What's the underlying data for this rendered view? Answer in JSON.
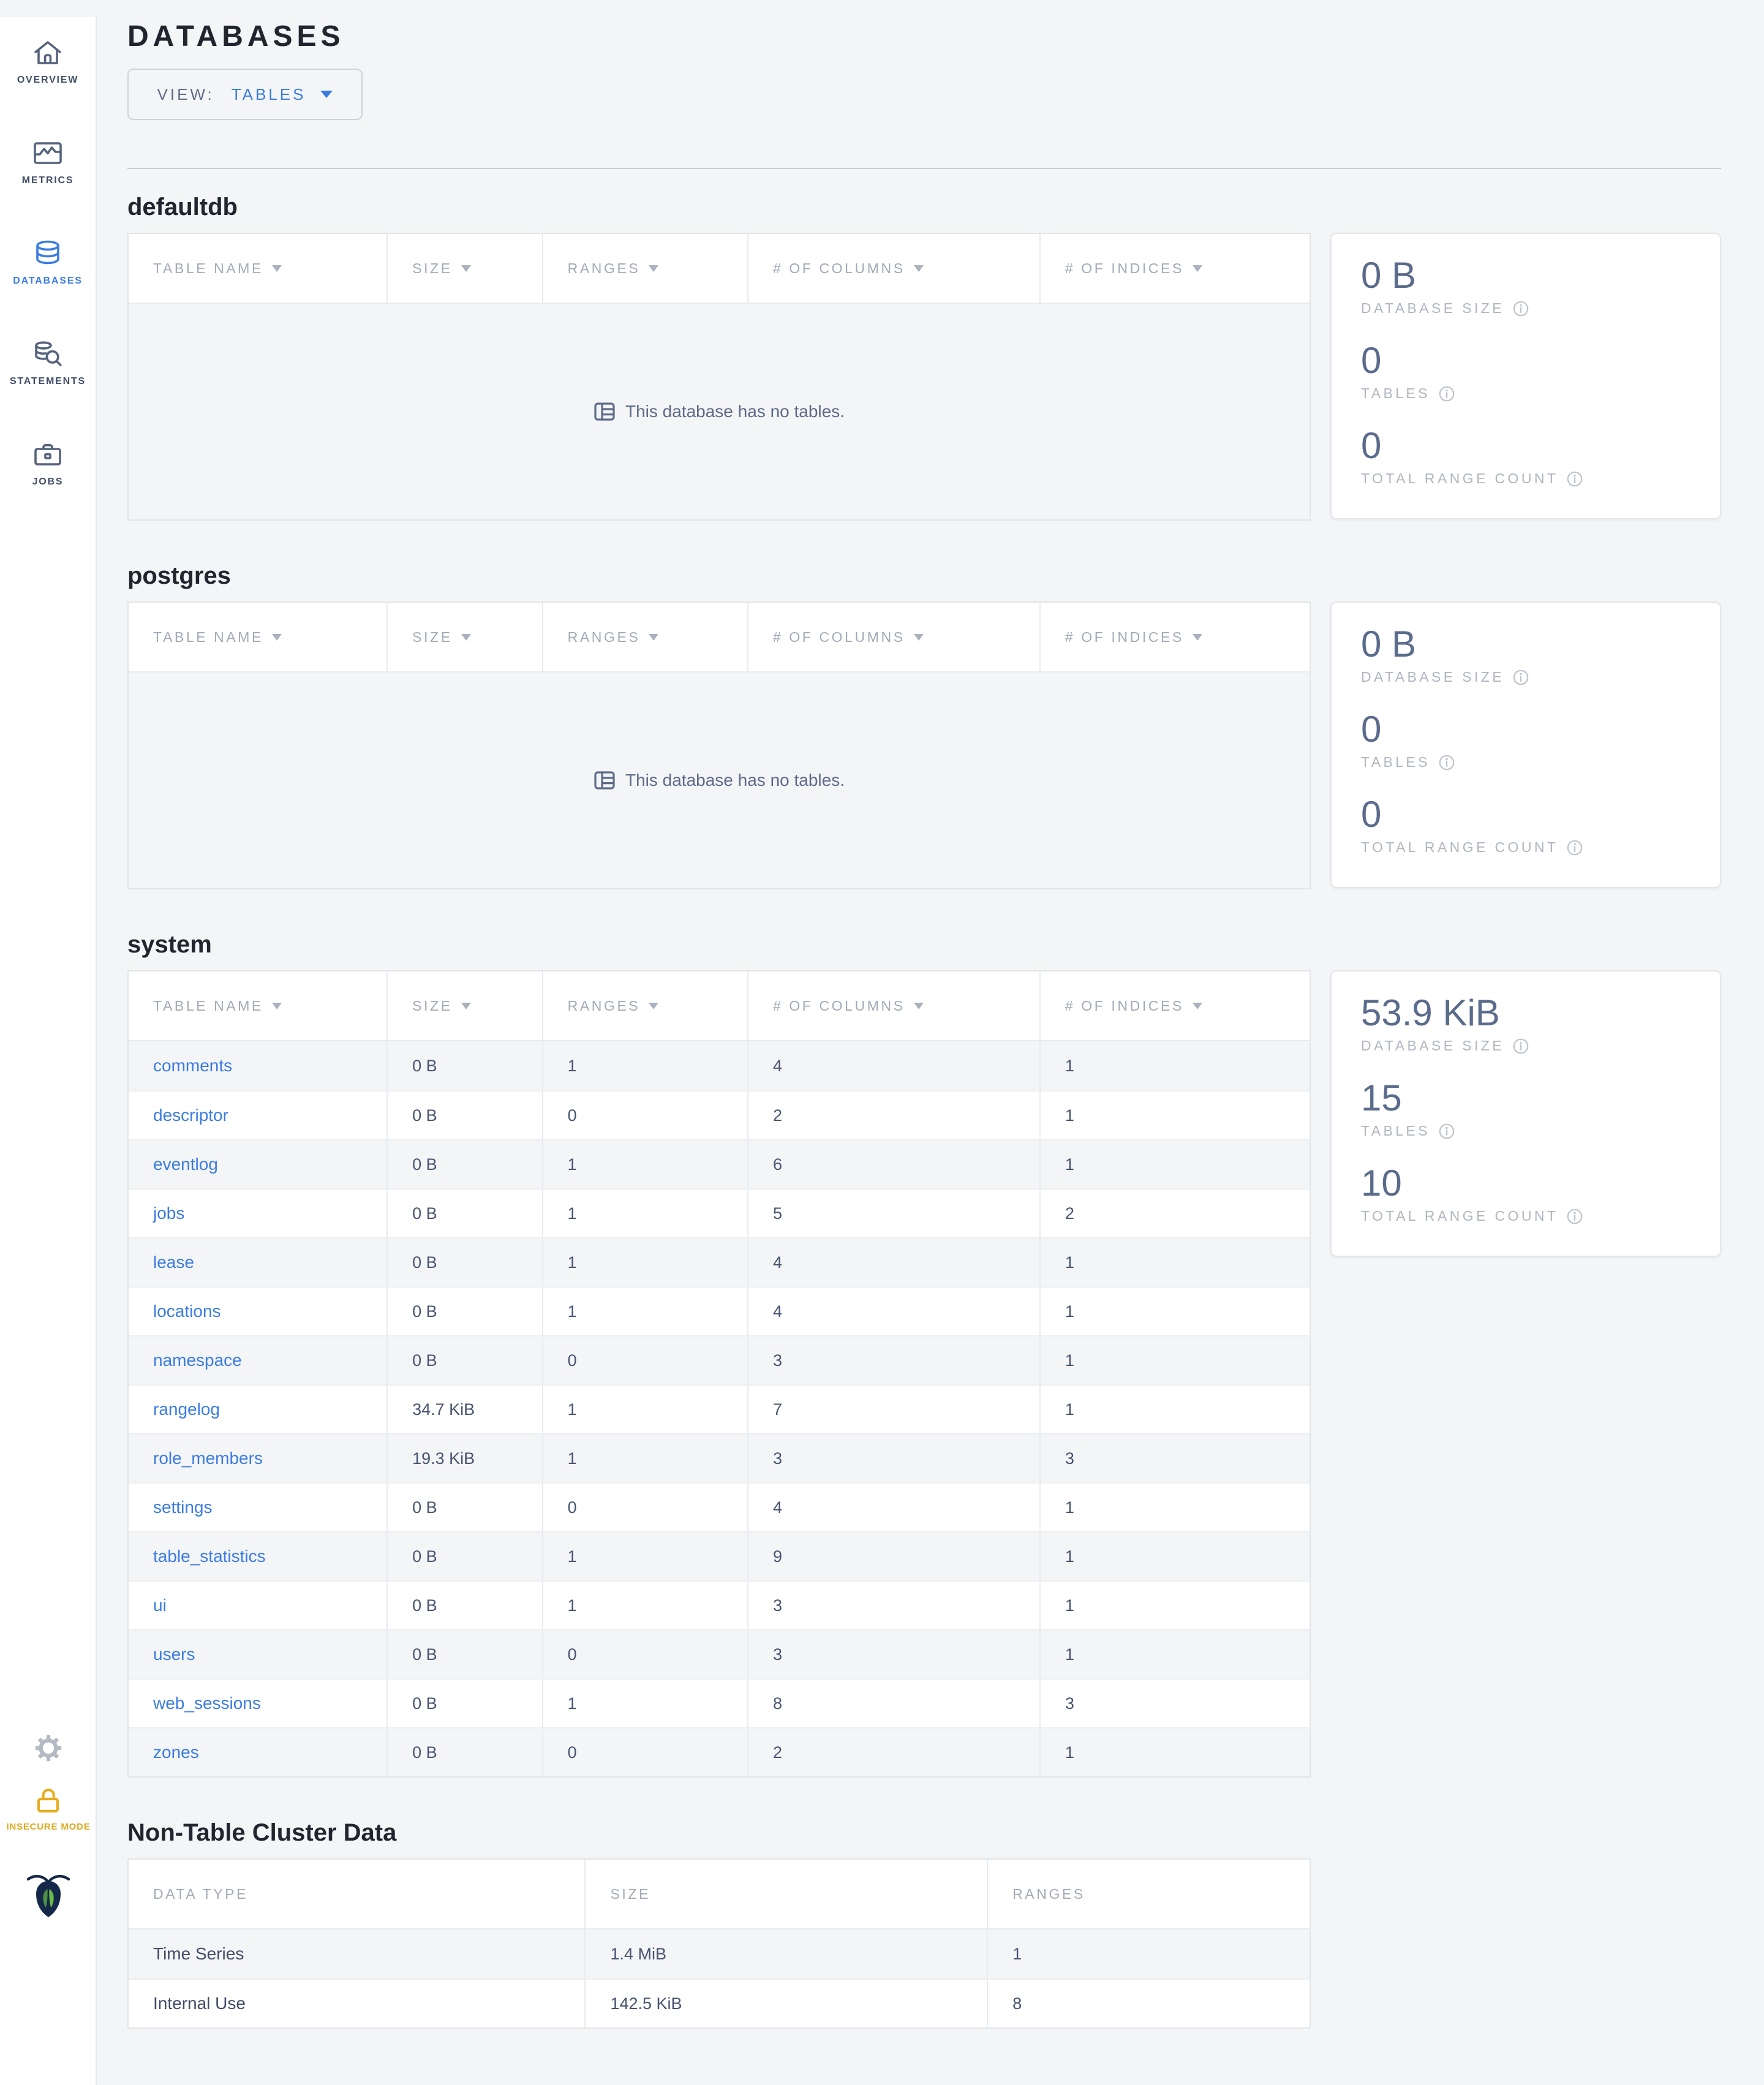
{
  "page": {
    "title": "DATABASES"
  },
  "view_selector": {
    "label": "VIEW:",
    "value": "TABLES"
  },
  "colors": {
    "accent_blue": "#3B7CE2",
    "insecure_yellow": "#E7AC1F",
    "stat_slate": "#5A6B8C"
  },
  "sidebar": {
    "items": [
      {
        "label": "OVERVIEW",
        "icon": "home-icon",
        "active": false
      },
      {
        "label": "METRICS",
        "icon": "metrics-icon",
        "active": false
      },
      {
        "label": "DATABASES",
        "icon": "database-icon",
        "active": true
      },
      {
        "label": "STATEMENTS",
        "icon": "statements-icon",
        "active": false
      },
      {
        "label": "JOBS",
        "icon": "jobs-icon",
        "active": false
      }
    ],
    "footer": {
      "gear_icon": "gear-icon",
      "insecure_mode": {
        "label": "INSECURE MODE",
        "icon": "unlock-icon"
      },
      "logo_icon": "cockroach-logo"
    }
  },
  "table_columns": [
    {
      "label": "TABLE NAME"
    },
    {
      "label": "SIZE"
    },
    {
      "label": "RANGES"
    },
    {
      "label": "# OF COLUMNS"
    },
    {
      "label": "# OF INDICES"
    }
  ],
  "empty_message": "This database has no tables.",
  "stats_labels": {
    "size": "DATABASE SIZE",
    "tables": "TABLES",
    "ranges": "TOTAL RANGE COUNT"
  },
  "databases": [
    {
      "name": "defaultdb",
      "empty": true,
      "stats": {
        "size": "0 B",
        "tables": "0",
        "ranges": "0"
      },
      "rows": []
    },
    {
      "name": "postgres",
      "empty": true,
      "stats": {
        "size": "0 B",
        "tables": "0",
        "ranges": "0"
      },
      "rows": []
    },
    {
      "name": "system",
      "empty": false,
      "stats": {
        "size": "53.9 KiB",
        "tables": "15",
        "ranges": "10"
      },
      "rows": [
        [
          "comments",
          "0 B",
          "1",
          "4",
          "1"
        ],
        [
          "descriptor",
          "0 B",
          "0",
          "2",
          "1"
        ],
        [
          "eventlog",
          "0 B",
          "1",
          "6",
          "1"
        ],
        [
          "jobs",
          "0 B",
          "1",
          "5",
          "2"
        ],
        [
          "lease",
          "0 B",
          "1",
          "4",
          "1"
        ],
        [
          "locations",
          "0 B",
          "1",
          "4",
          "1"
        ],
        [
          "namespace",
          "0 B",
          "0",
          "3",
          "1"
        ],
        [
          "rangelog",
          "34.7 KiB",
          "1",
          "7",
          "1"
        ],
        [
          "role_members",
          "19.3 KiB",
          "1",
          "3",
          "3"
        ],
        [
          "settings",
          "0 B",
          "0",
          "4",
          "1"
        ],
        [
          "table_statistics",
          "0 B",
          "1",
          "9",
          "1"
        ],
        [
          "ui",
          "0 B",
          "1",
          "3",
          "1"
        ],
        [
          "users",
          "0 B",
          "0",
          "3",
          "1"
        ],
        [
          "web_sessions",
          "0 B",
          "1",
          "8",
          "3"
        ],
        [
          "zones",
          "0 B",
          "0",
          "2",
          "1"
        ]
      ]
    }
  ],
  "non_table": {
    "title": "Non-Table Cluster Data",
    "columns": [
      "DATA TYPE",
      "SIZE",
      "RANGES"
    ],
    "rows": [
      [
        "Time Series",
        "1.4 MiB",
        "1"
      ],
      [
        "Internal Use",
        "142.5 KiB",
        "8"
      ]
    ]
  }
}
